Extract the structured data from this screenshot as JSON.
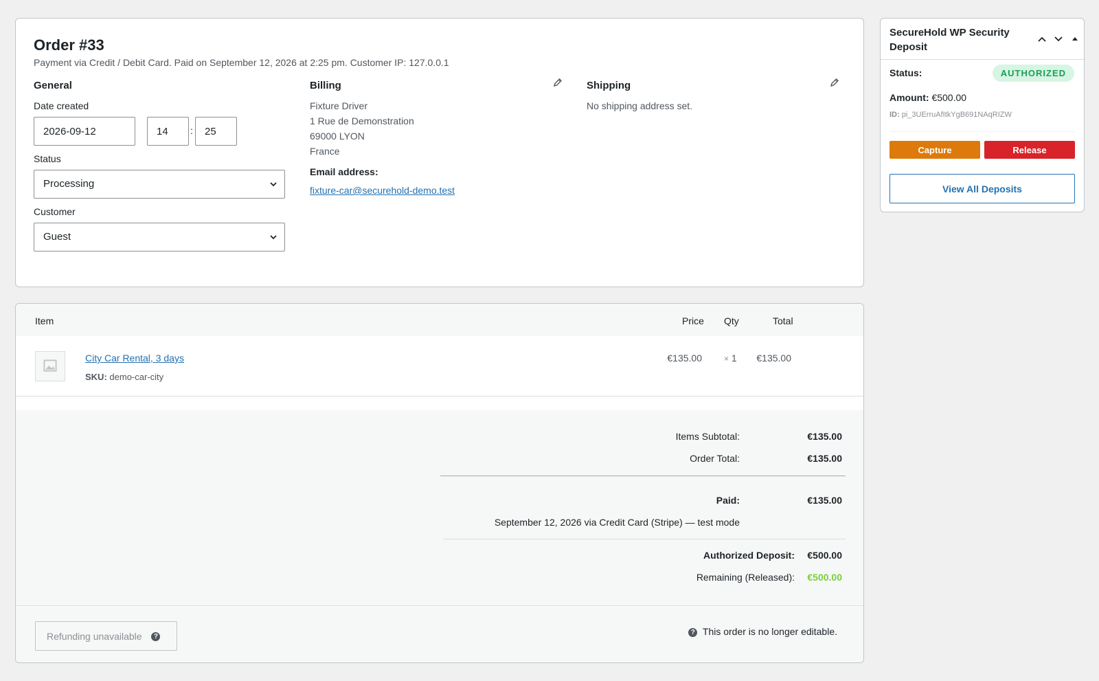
{
  "order": {
    "title": "Order #33",
    "subtitle": "Payment via Credit / Debit Card. Paid on September 12, 2026 at 2:25 pm. Customer IP: 127.0.0.1"
  },
  "general": {
    "heading": "General",
    "date_label": "Date created",
    "date_value": "2026-09-12",
    "hour_value": "14",
    "time_sep": ":",
    "minute_value": "25",
    "status_label": "Status",
    "status_value": "Processing",
    "customer_label": "Customer",
    "customer_value": "Guest"
  },
  "billing": {
    "heading": "Billing",
    "address_lines": [
      "Fixture Driver",
      "1 Rue de Demonstration",
      "69000 LYON",
      "France"
    ],
    "email_label": "Email address:",
    "email": "fixture-car@securehold-demo.test"
  },
  "shipping": {
    "heading": "Shipping",
    "note": "No shipping address set."
  },
  "items": {
    "columns": {
      "item": "Item",
      "price": "Price",
      "qty": "Qty",
      "total": "Total"
    },
    "rows": [
      {
        "name": "City Car Rental, 3 days",
        "sku_label": "SKU:",
        "sku": "demo-car-city",
        "price": "€135.00",
        "qty_prefix": "×",
        "qty": "1",
        "total": "€135.00"
      }
    ]
  },
  "totals": {
    "subtotal_label": "Items Subtotal:",
    "subtotal": "€135.00",
    "order_total_label": "Order Total:",
    "order_total": "€135.00",
    "paid_label": "Paid:",
    "paid": "€135.00",
    "paid_note": "September 12, 2026 via Credit Card (Stripe) — test mode",
    "deposit_label": "Authorized Deposit:",
    "deposit": "€500.00",
    "remaining_label": "Remaining (Released):",
    "remaining": "€500.00",
    "remaining_color": "#7ad03a"
  },
  "footer": {
    "refund_label": "Refunding unavailable",
    "not_editable": "This order is no longer editable."
  },
  "deposit_box": {
    "title": "SecureHold WP Security Deposit",
    "status_label": "Status:",
    "status": "AUTHORIZED",
    "amount_label": "Amount:",
    "amount": "€500.00",
    "id_label": "ID:",
    "id": "pi_3UErruAfItkYgB691NAqRIZW",
    "capture_label": "Capture",
    "release_label": "Release",
    "view_all_label": "View All Deposits",
    "capture_color": "#dd7a0b",
    "release_color": "#d8232a"
  },
  "icons": {
    "edit": "pencil-icon",
    "dropdown": "chevron-down-icon",
    "help": "help-icon",
    "placeholder": "image-placeholder-icon"
  }
}
